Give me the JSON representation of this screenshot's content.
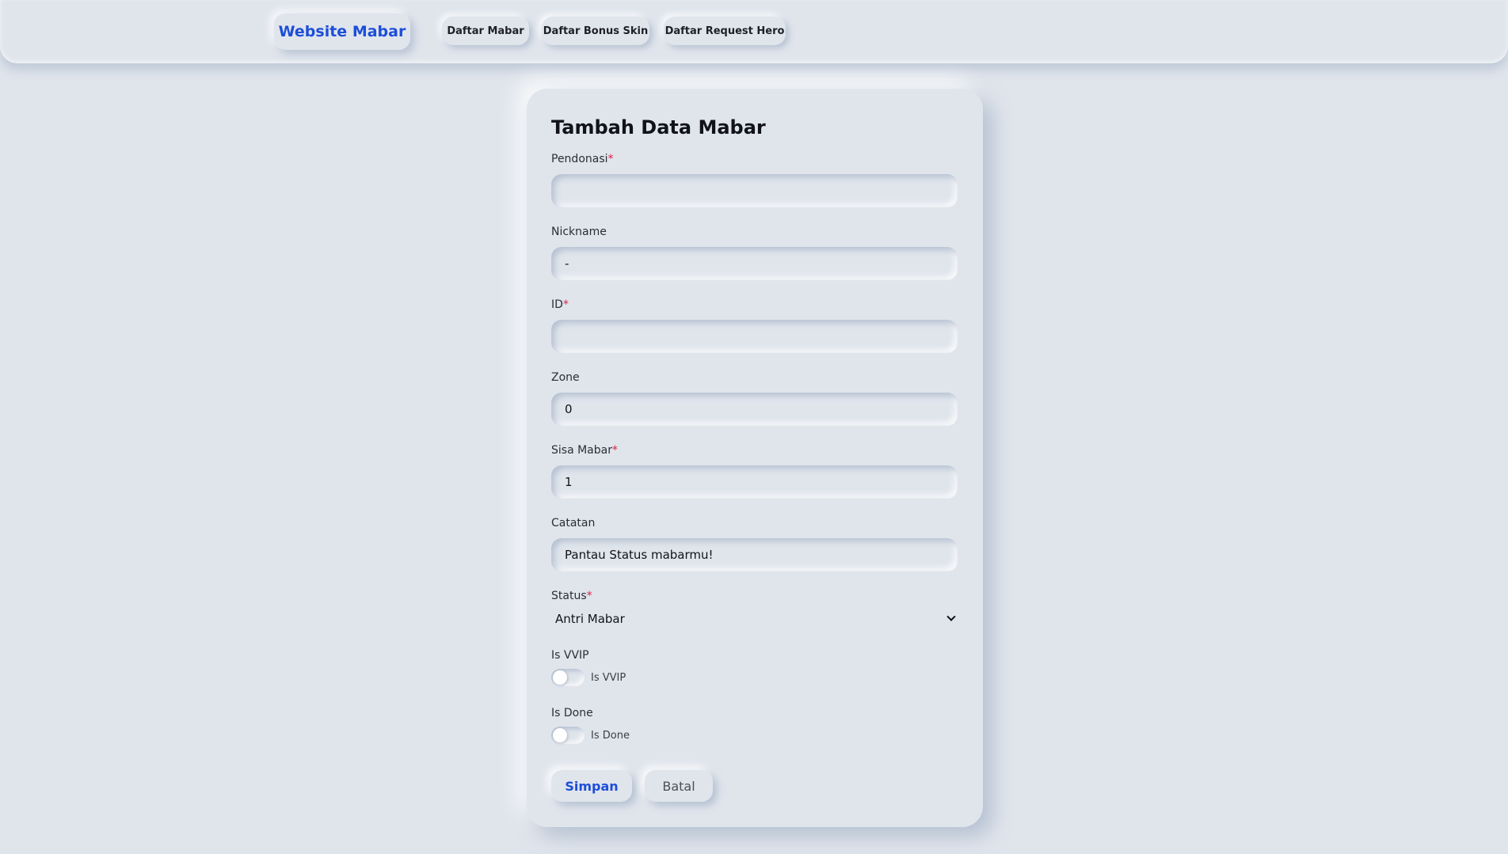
{
  "nav": {
    "brand": "Website Mabar",
    "links": [
      "Daftar Mabar",
      "Daftar Bonus Skin",
      "Daftar Request Hero"
    ]
  },
  "form": {
    "title": "Tambah Data Mabar",
    "required_marker": "*",
    "fields": {
      "pendonasi": {
        "label": "Pendonasi",
        "value": ""
      },
      "nickname": {
        "label": "Nickname",
        "value": "-"
      },
      "id": {
        "label": "ID",
        "value": ""
      },
      "zone": {
        "label": "Zone",
        "value": "0"
      },
      "sisa_mabar": {
        "label": "Sisa Mabar",
        "value": "1"
      },
      "catatan": {
        "label": "Catatan",
        "value": "Pantau Status mabarmu!"
      }
    },
    "status": {
      "label": "Status",
      "selected": "Antri Mabar"
    },
    "is_vvip": {
      "label": "Is VVIP",
      "toggle_label": "Is VVIP",
      "checked": false
    },
    "is_done": {
      "label": "Is Done",
      "toggle_label": "Is Done",
      "checked": false
    },
    "buttons": {
      "save": "Simpan",
      "cancel": "Batal"
    }
  },
  "colors": {
    "background": "#e0e5ec",
    "accent": "#1d4ed8",
    "required": "#e11d48"
  }
}
